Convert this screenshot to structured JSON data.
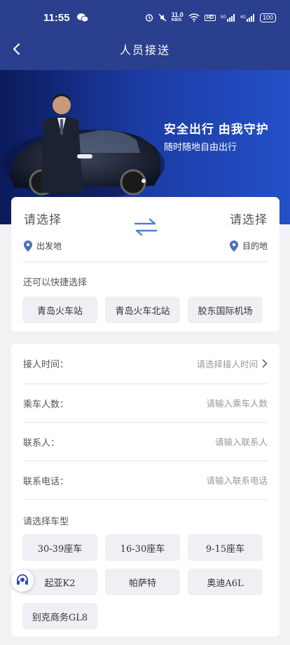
{
  "status_bar": {
    "time": "11:55",
    "speed": "11.0",
    "speed_unit": "KB/S",
    "hd": "HD",
    "signal1": "5G",
    "signal2": "4G",
    "battery": "100"
  },
  "nav": {
    "title": "人员接送"
  },
  "banner": {
    "headline": "安全出行 由我守护",
    "subline": "随时随地自由出行"
  },
  "route": {
    "from_placeholder": "请选择",
    "from_tag": "出发地",
    "to_placeholder": "请选择",
    "to_tag": "目的地",
    "quick_title": "还可以快捷选择",
    "quick_options": [
      "青岛火车站",
      "青岛火车北站",
      "胶东国际机场"
    ]
  },
  "form": {
    "time_label": "接人时间：",
    "time_placeholder": "请选择接人时间",
    "passengers_label": "乘车人数：",
    "passengers_placeholder": "请输入乘车人数",
    "contact_label": "联系人：",
    "contact_placeholder": "请输入联系人",
    "phone_label": "联系电话：",
    "phone_placeholder": "请输入联系电话",
    "cartype_title": "请选择车型",
    "car_types": [
      "30-39座车",
      "16-30座车",
      "9-15座车",
      "起亚K2",
      "帕萨特",
      "奥迪A6L",
      "别克商务GL8"
    ]
  },
  "colors": {
    "header_bg": "#2a3f8e",
    "accent_blue": "#4a7fd0",
    "chip_bg": "#eef0f3"
  }
}
